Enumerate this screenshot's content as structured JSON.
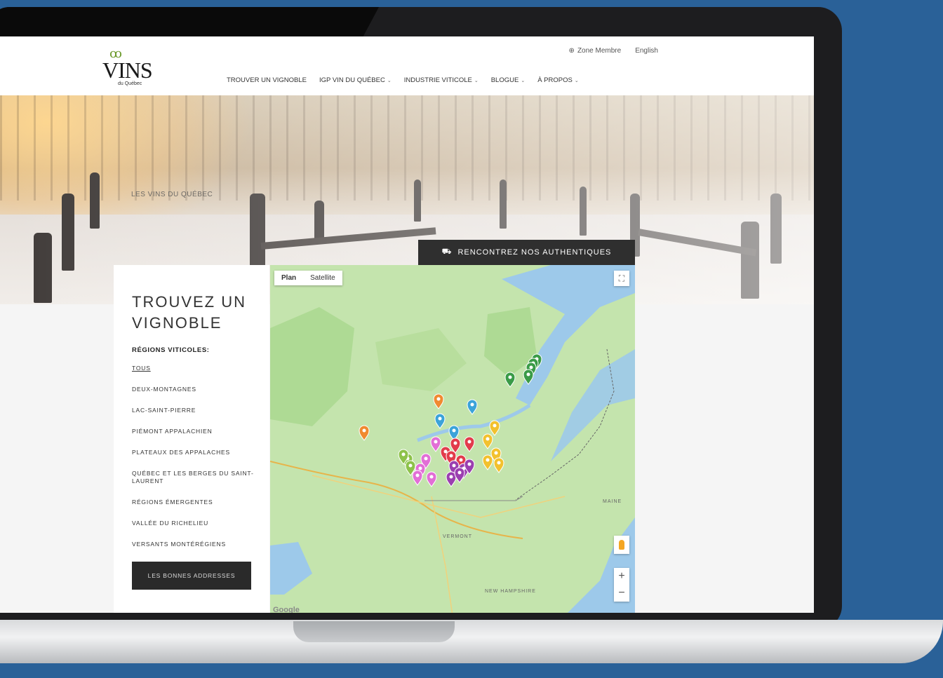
{
  "header": {
    "logo_text": "VINS",
    "logo_sub": "du Québec",
    "utility": {
      "member": "Zone Membre",
      "language": "English"
    },
    "nav": [
      {
        "label": "TROUVER UN VIGNOBLE",
        "dropdown": false
      },
      {
        "label": "IGP VIN DU QUÉBEC",
        "dropdown": true
      },
      {
        "label": "INDUSTRIE VITICOLE",
        "dropdown": true
      },
      {
        "label": "BLOGUE",
        "dropdown": true
      },
      {
        "label": "À PROPOS",
        "dropdown": true
      }
    ]
  },
  "hero": {
    "caption": "LES VINS DU QUÉBEC",
    "cta": "RENCONTREZ NOS AUTHENTIQUES"
  },
  "finder": {
    "title": "TROUVEZ UN VIGNOBLE",
    "regions_heading": "RÉGIONS VITICOLES:",
    "regions": [
      "TOUS",
      "DEUX-MONTAGNES",
      "LAC-SAINT-PIERRE",
      "PIÉMONT APPALACHIEN",
      "PLATEAUX DES APPALACHES",
      "QUÉBEC ET LES BERGES DU SAINT-LAURENT",
      "RÉGIONS ÉMERGENTES",
      "VALLÉE DU RICHELIEU",
      "VERSANTS MONTÉRÉGIENS"
    ],
    "button": "LES BONNES ADDRESSES"
  },
  "map": {
    "type_tabs": [
      "Plan",
      "Satellite"
    ],
    "active_tab": "Plan",
    "labels": {
      "vermont": "VERMONT",
      "maine": "MAINE",
      "new_hampshire": "NEW HAMPSHIRE"
    },
    "zoom_in": "+",
    "zoom_out": "−",
    "attribution": "Google"
  }
}
